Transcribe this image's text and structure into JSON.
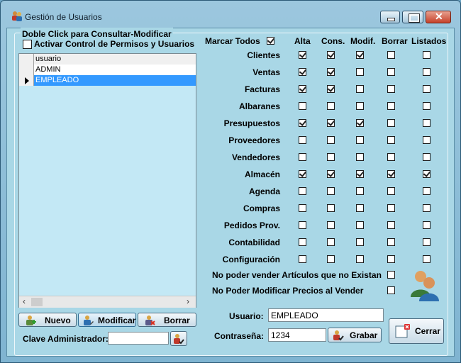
{
  "window": {
    "title": "Gestión de Usuarios"
  },
  "left": {
    "group_caption": "Doble Click para Consultar-Modificar",
    "activate_label": "Activar Control de Permisos y Usuarios",
    "activate_checked": false,
    "grid_header": "usuario",
    "rows": [
      "ADMIN",
      "EMPLEADO"
    ],
    "selected_row": "EMPLEADO",
    "buttons": {
      "new": "Nuevo",
      "modify": "Modificar",
      "delete": "Borrar"
    },
    "admin_key_label": "Clave Administrador:",
    "admin_key_value": ""
  },
  "perms": {
    "mark_all_label": "Marcar Todos",
    "mark_all_checked": true,
    "columns": [
      "Alta",
      "Cons.",
      "Modif.",
      "Borrar",
      "Listados"
    ],
    "rows": [
      {
        "name": "Clientes",
        "checks": [
          true,
          true,
          true,
          false,
          false
        ]
      },
      {
        "name": "Ventas",
        "checks": [
          true,
          true,
          false,
          false,
          false
        ]
      },
      {
        "name": "Facturas",
        "checks": [
          true,
          true,
          false,
          false,
          false
        ]
      },
      {
        "name": "Albaranes",
        "checks": [
          false,
          false,
          false,
          false,
          false
        ]
      },
      {
        "name": "Presupuestos",
        "checks": [
          true,
          true,
          true,
          false,
          false
        ]
      },
      {
        "name": "Proveedores",
        "checks": [
          false,
          false,
          false,
          false,
          false
        ]
      },
      {
        "name": "Vendedores",
        "checks": [
          false,
          false,
          false,
          false,
          false
        ]
      },
      {
        "name": "Almacén",
        "checks": [
          true,
          true,
          true,
          true,
          true
        ]
      },
      {
        "name": "Agenda",
        "checks": [
          false,
          false,
          false,
          false,
          false
        ]
      },
      {
        "name": "Compras",
        "checks": [
          false,
          false,
          false,
          false,
          false
        ]
      },
      {
        "name": "Pedidos Prov.",
        "checks": [
          false,
          false,
          false,
          false,
          false
        ]
      },
      {
        "name": "Contabilidad",
        "checks": [
          false,
          false,
          false,
          false,
          false
        ]
      },
      {
        "name": "Configuración",
        "checks": [
          false,
          false,
          false,
          false,
          false
        ]
      }
    ],
    "no_sell_label": "No poder vender Artículos que no Existan",
    "no_sell_checked": false,
    "no_price_label": "No Poder Modificar Precios al Vender",
    "no_price_checked": false
  },
  "form": {
    "user_label": "Usuario:",
    "user_value": "EMPLEADO",
    "pass_label": "Contraseña:",
    "pass_value": "1234",
    "save_label": "Grabar",
    "close_label": "Cerrar"
  },
  "icons": {
    "app": "users-icon",
    "new": "add-user-icon",
    "modify": "edit-user-icon",
    "delete": "delete-user-icon",
    "avatar": "user-avatar-icon"
  }
}
